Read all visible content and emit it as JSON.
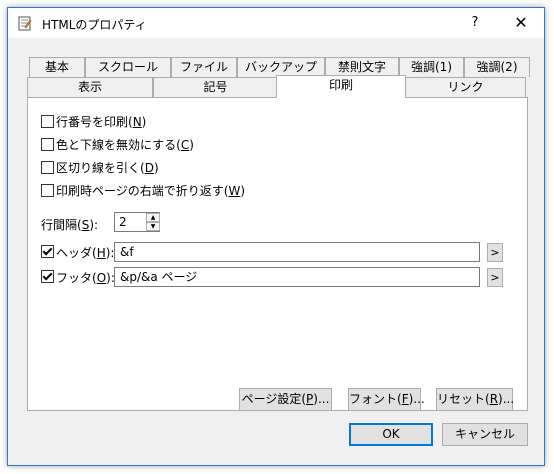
{
  "window": {
    "title": "HTMLのプロパティ",
    "help": "?",
    "close": "✕",
    "app_icon": "document-icon"
  },
  "tabs_row1": [
    "基本",
    "スクロール",
    "ファイル",
    "バックアップ",
    "禁則文字",
    "強調(1)",
    "強調(2)"
  ],
  "tabs_row2": [
    "表示",
    "記号",
    "印刷",
    "リンク"
  ],
  "active_tab": "印刷",
  "options": [
    {
      "label": "行番号を印刷(",
      "key": "N",
      "suffix": ")",
      "checked": false
    },
    {
      "label": "色と下線を無効にする(",
      "key": "C",
      "suffix": ")",
      "checked": false
    },
    {
      "label": "区切り線を引く(",
      "key": "D",
      "suffix": ")",
      "checked": false
    },
    {
      "label": "印刷時ページの右端で折り返す(",
      "key": "W",
      "suffix": ")",
      "checked": false
    }
  ],
  "line_spacing": {
    "label": "行間隔(",
    "key": "S",
    "suffix": "):",
    "value": "2"
  },
  "header": {
    "label": "ヘッダ(",
    "key": "H",
    "suffix": "):",
    "checked": true,
    "value": "&f",
    "button": ">"
  },
  "footer": {
    "label": "フッタ(",
    "key": "O",
    "suffix": "):",
    "checked": true,
    "value": "&p/&a ページ",
    "button": ">"
  },
  "panel_buttons": {
    "page_setup": {
      "label": "ページ設定(",
      "key": "P",
      "suffix": ")..."
    },
    "font": {
      "label": "フォント(",
      "key": "F",
      "suffix": ")..."
    },
    "reset": {
      "label": "リセット(",
      "key": "R",
      "suffix": ")..."
    }
  },
  "dialog_buttons": {
    "ok": "OK",
    "cancel": "キャンセル"
  }
}
